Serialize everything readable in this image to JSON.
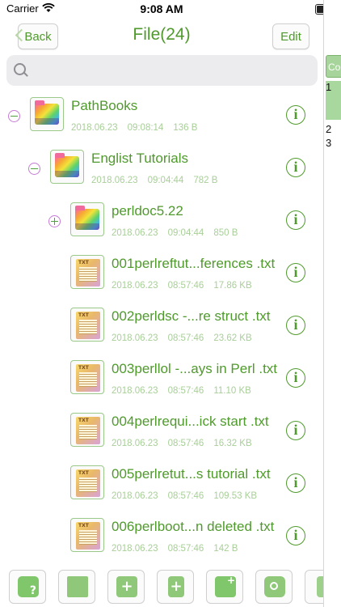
{
  "status_bar": {
    "carrier": "Carrier",
    "time": "9:08 AM"
  },
  "nav": {
    "back_label": "Back",
    "title": "File(24)",
    "edit_label": "Edit"
  },
  "search": {
    "placeholder": ""
  },
  "side_panel": {
    "tab_label": "Co",
    "line_numbers": [
      "1",
      "2",
      "3"
    ]
  },
  "colors": {
    "accent": "#4f9a2c",
    "meta_text": "#a8cf98",
    "toggle_ring": "#c67bd6"
  },
  "items": [
    {
      "name": "PathBooks",
      "date": "2018.06.23",
      "time": "09:08:14",
      "size": "136 B",
      "kind": "folder",
      "toggle": "minus",
      "level": 0
    },
    {
      "name": "Englist Tutorials",
      "date": "2018.06.23",
      "time": "09:04:44",
      "size": "782 B",
      "kind": "folder",
      "toggle": "minus",
      "level": 1
    },
    {
      "name": "perldoc5.22",
      "date": "2018.06.23",
      "time": "09:04:44",
      "size": "850 B",
      "kind": "folder",
      "toggle": "plus",
      "level": 2
    },
    {
      "name": "001perlreftut...ferences .txt",
      "date": "2018.06.23",
      "time": "08:57:46",
      "size": "17.86 KB",
      "kind": "txt",
      "level": 2
    },
    {
      "name": "002perldsc -...re struct .txt",
      "date": "2018.06.23",
      "time": "08:57:46",
      "size": "23.62 KB",
      "kind": "txt",
      "level": 2
    },
    {
      "name": "003perllol -...ays in Perl .txt",
      "date": "2018.06.23",
      "time": "08:57:46",
      "size": "11.10 KB",
      "kind": "txt",
      "level": 2
    },
    {
      "name": "004perlrequi...ick start .txt",
      "date": "2018.06.23",
      "time": "08:57:46",
      "size": "16.32 KB",
      "kind": "txt",
      "level": 2
    },
    {
      "name": "005perlretut...s tutorial .txt",
      "date": "2018.06.23",
      "time": "08:57:46",
      "size": "109.53 KB",
      "kind": "txt",
      "level": 2
    },
    {
      "name": "006perlboot...n deleted .txt",
      "date": "2018.06.23",
      "time": "08:57:46",
      "size": "142 B",
      "kind": "txt",
      "level": 2
    }
  ],
  "info_glyph": "i",
  "toolbar": [
    {
      "name": "sort-help-icon",
      "glyph": "sort"
    },
    {
      "name": "open-folder-icon",
      "glyph": "open"
    },
    {
      "name": "new-folder-icon",
      "glyph": "folderplus"
    },
    {
      "name": "new-file-icon",
      "glyph": "fileplus"
    },
    {
      "name": "add-image-icon",
      "glyph": "image"
    },
    {
      "name": "camera-icon",
      "glyph": "camera"
    },
    {
      "name": "image-document-icon",
      "glyph": "imgdoc"
    }
  ]
}
